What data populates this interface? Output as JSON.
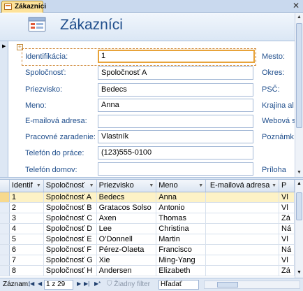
{
  "tab": {
    "label": "Zákazníci"
  },
  "header": {
    "title": "Zákazníci"
  },
  "form": {
    "fields": [
      {
        "label": "Identifikácia:",
        "value": "1"
      },
      {
        "label": "Spoločnosť:",
        "value": "Spoločnosť A"
      },
      {
        "label": "Priezvisko:",
        "value": "Bedecs"
      },
      {
        "label": "Meno:",
        "value": "Anna"
      },
      {
        "label": "E-mailová adresa:",
        "value": ""
      },
      {
        "label": "Pracovné zaradenie:",
        "value": "Vlastník"
      },
      {
        "label": "Telefón do práce:",
        "value": "(123)555-0100"
      },
      {
        "label": "Telefón domov:",
        "value": ""
      }
    ],
    "right_labels": [
      "Mesto:",
      "Okres:",
      "PSČ:",
      "Krajina al",
      "Webová s",
      "Poznámk",
      "Príloha"
    ]
  },
  "datasheet": {
    "columns": [
      "Identif",
      "Spoločnosť",
      "Priezvisko",
      "Meno",
      "E-mailová adresa",
      "P"
    ],
    "rows": [
      [
        "1",
        "Spoločnosť A",
        "Bedecs",
        "Anna",
        "",
        "Vl"
      ],
      [
        "2",
        "Spoločnosť B",
        "Gratacos Solso",
        "Antonio",
        "",
        "Vl"
      ],
      [
        "3",
        "Spoločnosť C",
        "Axen",
        "Thomas",
        "",
        "Zá"
      ],
      [
        "4",
        "Spoločnosť D",
        "Lee",
        "Christina",
        "",
        "Ná"
      ],
      [
        "5",
        "Spoločnosť E",
        "O’Donnell",
        "Martin",
        "",
        "Vl"
      ],
      [
        "6",
        "Spoločnosť F",
        "Pérez-Olaeta",
        "Francisco",
        "",
        "Ná"
      ],
      [
        "7",
        "Spoločnosť G",
        "Xie",
        "Ming-Yang",
        "",
        "Vl"
      ],
      [
        "8",
        "Spoločnosť H",
        "Andersen",
        "Elizabeth",
        "",
        "Zá"
      ]
    ]
  },
  "navbar": {
    "record_label": "Záznam:",
    "record_value": "1 z 29",
    "filter_label": "Žiadny filter",
    "search_placeholder": "Hľadať"
  },
  "icons": [
    "form-icon",
    "close-icon",
    "record-selector-arrow-icon",
    "move-handle-icon",
    "dropdown-arrow-icon",
    "nav-first-icon",
    "nav-prev-icon",
    "nav-next-icon",
    "nav-last-icon",
    "nav-new-icon",
    "filter-icon"
  ]
}
